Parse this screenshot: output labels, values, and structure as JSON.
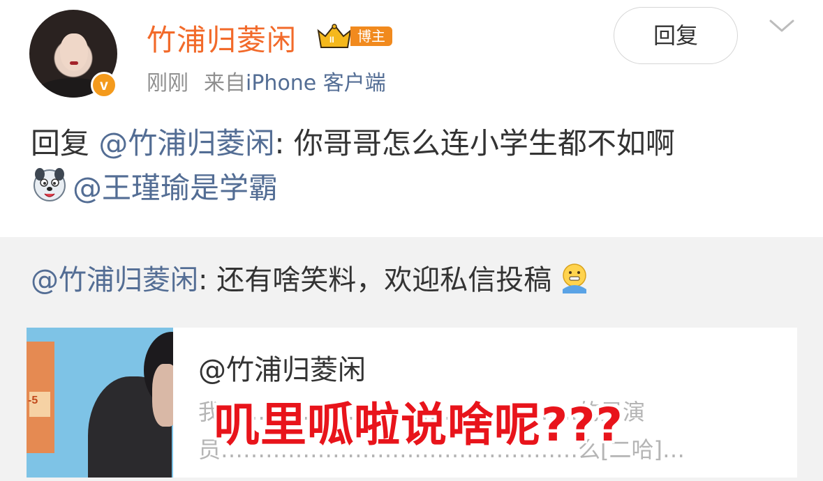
{
  "post": {
    "username": "竹浦归菱闲",
    "badge_label": "博主",
    "time": "刚刚",
    "source_prefix": "来自",
    "source_device": "iPhone 客户端",
    "reply_button": "回复",
    "content": {
      "prefix": "回复",
      "mention_1": "@竹浦归菱闲",
      "text": ": 你哥哥怎么连小学生都不如啊",
      "emoji_icon": "dog-face-emoji",
      "mention_2": "@王瑾瑜是学霸"
    }
  },
  "repost": {
    "mention": "@竹浦归菱闲",
    "text": ": 还有啥笑料，欢迎私信投稿",
    "emoji_icon": "face-with-hand-over-mouth-emoji",
    "card": {
      "author": "@竹浦归菱闲",
      "snippet_line_1": "我…………………………………………的男演",
      "snippet_line_2": "员…………………………………………么[二哈]…"
    }
  },
  "overlay": {
    "caption": "叽里呱啦说啥呢???"
  },
  "colors": {
    "username_orange": "#f26a2a",
    "badge_orange": "#f18a1e",
    "link_blue": "#536d94",
    "overlay_red": "#e8141b",
    "repost_bg": "#f2f2f2"
  }
}
